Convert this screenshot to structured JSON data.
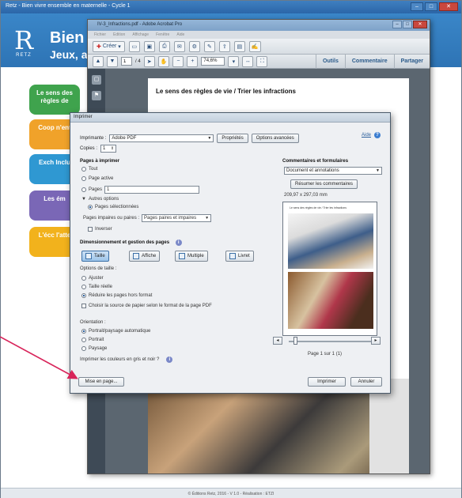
{
  "app": {
    "window_title": "Retz - Bien vivre ensemble en maternelle - Cycle 1",
    "title": "Bien vi",
    "subtitle": "Jeux, ac",
    "logo_text": "RETZ",
    "footer": "© Éditions Retz, 2016 - V 1.0 - Réalisation : ETZI",
    "nav_buttons": [
      {
        "label": "Le sens des règles de",
        "color": "#3fa34d"
      },
      {
        "label": "Coop n'ent",
        "color": "#f0a22a"
      },
      {
        "label": "Exch Inclu",
        "color": "#2f98d2"
      },
      {
        "label": "Les ém",
        "color": "#7a67b6"
      },
      {
        "label": "L'écc l'atte",
        "color": "#f2b21c"
      }
    ]
  },
  "acrobat": {
    "title": "IV-3_Infractions.pdf - Adobe Acrobat Pro",
    "menu": [
      "Fichier",
      "Edition",
      "Affichage",
      "Fenêtre",
      "Aide"
    ],
    "create_label": "Créer",
    "page_current": "1",
    "page_total": "/ 4",
    "zoom": "74,6%",
    "right_tabs": [
      "Outils",
      "Commentaire",
      "Partager"
    ],
    "doc_heading": "Le sens des règles de vie / Trier les infractions"
  },
  "print_dialog": {
    "title": "Imprimer",
    "printer_label": "Imprimante :",
    "printer_value": "Adobe PDF",
    "properties_button": "Propriétés",
    "advanced_button": "Options avancées",
    "help_label": "Aide",
    "copies_label": "Copies :",
    "copies_value": "1",
    "pages_section": "Pages à imprimer",
    "pages_all": "Tout",
    "pages_current": "Page active",
    "pages_range": "Pages",
    "pages_range_value": "1",
    "more_options": "Autres options",
    "selected_pages": "Pages sélectionnées",
    "odd_even_label": "Pages impaires ou paires :",
    "odd_even_value": "Pages paires et impaires",
    "invert": "Inverser",
    "sizing_section": "Dimensionnement et gestion des pages",
    "tab_size": "Taille",
    "tab_poster": "Affiche",
    "tab_multiple": "Multiple",
    "tab_booklet": "Livret",
    "size_options_label": "Options de taille :",
    "size_fit": "Ajuster",
    "size_actual": "Taille réelle",
    "size_shrink": "Réduire les pages hors format",
    "paper_source": "Choisir la source de papier selon le format de la page PDF",
    "orientation_label": "Orientation :",
    "orient_auto": "Portrait/paysage automatique",
    "orient_portrait": "Portrait",
    "orient_landscape": "Paysage",
    "grayscale": "Imprimer les couleurs en gris et noir ?",
    "page_setup_button": "Mise en page...",
    "print_button": "Imprimer",
    "cancel_button": "Annuler",
    "comments_section": "Commentaires et formulaires",
    "comments_value": "Document et annotations",
    "summarize_button": "Résumer les commentaires",
    "paper_size": "209,97 x 297,03 mm",
    "preview_caption": "Le sens des règles de vie / Trier les infractions",
    "page_of": "Page 1 sur 1 (1)"
  },
  "colors": {
    "annotation_arrow": "#d8245a",
    "header_blue": "#2e74b5"
  }
}
